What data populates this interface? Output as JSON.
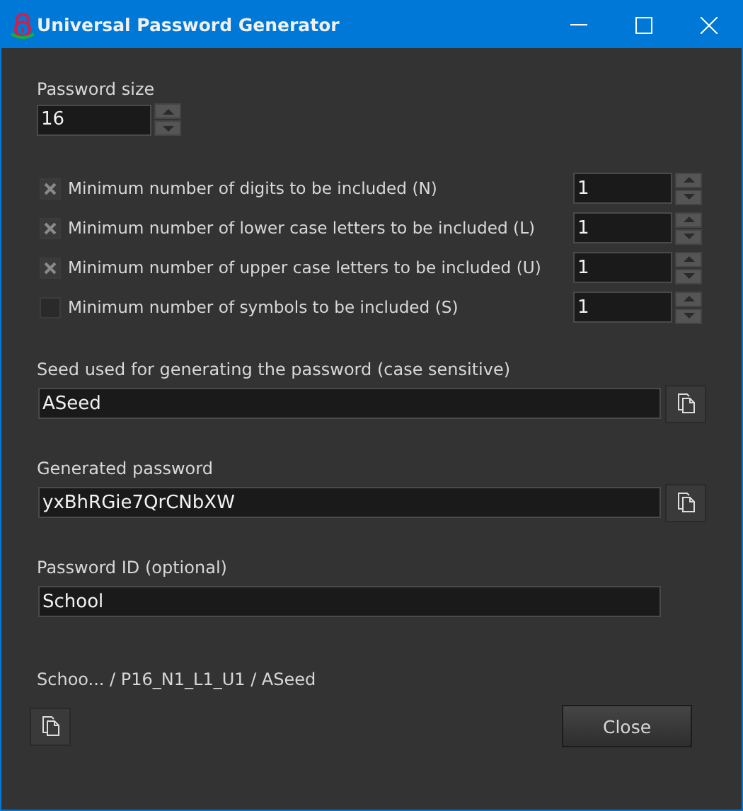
{
  "window": {
    "title": "Universal Password Generator"
  },
  "password_size": {
    "label": "Password size",
    "value": "16"
  },
  "minimums": [
    {
      "label": "Minimum number of digits to be included (N)",
      "checked": true,
      "value": "1"
    },
    {
      "label": "Minimum number of lower case letters to be included (L)",
      "checked": true,
      "value": "1"
    },
    {
      "label": "Minimum number of upper case letters to be included (U)",
      "checked": true,
      "value": "1"
    },
    {
      "label": "Minimum number of symbols to be included (S)",
      "checked": false,
      "value": "1"
    }
  ],
  "fields": [
    {
      "label": "Seed used for generating the password (case sensitive)",
      "value": "ASeed",
      "copy_button": true
    },
    {
      "label": "Generated password",
      "value": "yxBhRGie7QrCNbXW",
      "copy_button": true
    },
    {
      "label": "Password ID (optional)",
      "value": "School",
      "copy_button": false
    }
  ],
  "summary": "Schoo... / P16_N1_L1_U1 / ASeed",
  "buttons": {
    "close": "Close"
  }
}
